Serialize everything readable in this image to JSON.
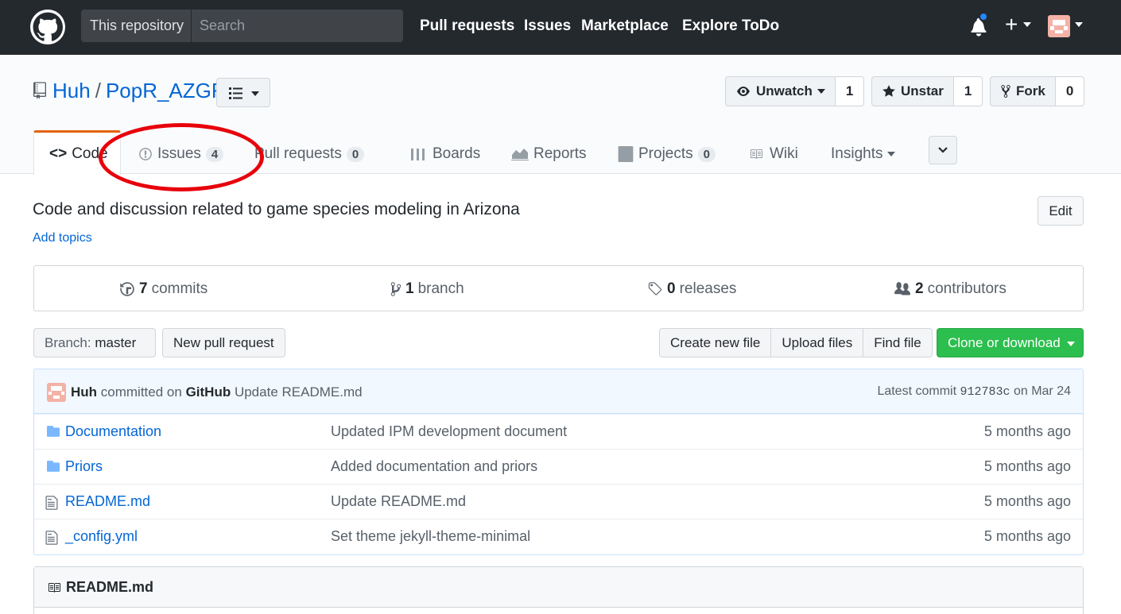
{
  "header": {
    "scope_label": "This repository",
    "search_placeholder": "Search",
    "nav": [
      "Pull requests",
      "Issues",
      "Marketplace",
      "Explore",
      "ToDo"
    ]
  },
  "repo": {
    "owner": "Huh",
    "name": "PopR_AZGF",
    "watch_label": "Unwatch",
    "watch_count": "1",
    "star_label": "Unstar",
    "star_count": "1",
    "fork_label": "Fork",
    "fork_count": "0"
  },
  "tabs": {
    "code": "Code",
    "issues": "Issues",
    "issues_count": "4",
    "pulls": "Pull requests",
    "pulls_count": "0",
    "boards": "Boards",
    "reports": "Reports",
    "projects": "Projects",
    "projects_count": "0",
    "wiki": "Wiki",
    "insights": "Insights"
  },
  "about": {
    "description": "Code and discussion related to game species modeling in Arizona",
    "add_topics": "Add topics",
    "edit": "Edit"
  },
  "summary": {
    "commits_count": "7",
    "commits_label": "commits",
    "branch_count": "1",
    "branch_label": "branch",
    "releases_count": "0",
    "releases_label": "releases",
    "contributors_count": "2",
    "contributors_label": "contributors"
  },
  "toolbar": {
    "branch_prefix": "Branch:",
    "branch_name": "master",
    "new_pr": "New pull request",
    "create_file": "Create new file",
    "upload_files": "Upload files",
    "find_file": "Find file",
    "clone": "Clone or download"
  },
  "commit": {
    "author": "Huh",
    "committed_on": "committed on",
    "platform": "GitHub",
    "message": "Update README.md",
    "latest_label": "Latest commit",
    "sha": "912783c",
    "date": "on Mar 24"
  },
  "files": [
    {
      "name": "Documentation",
      "type": "folder",
      "message": "Updated IPM development document",
      "age": "5 months ago"
    },
    {
      "name": "Priors",
      "type": "folder",
      "message": "Added documentation and priors",
      "age": "5 months ago"
    },
    {
      "name": "README.md",
      "type": "file",
      "message": "Update README.md",
      "age": "5 months ago"
    },
    {
      "name": "_config.yml",
      "type": "file",
      "message": "Set theme jekyll-theme-minimal",
      "age": "5 months ago"
    }
  ],
  "readme": {
    "title": "README.md"
  },
  "colors": {
    "accent": "#0366d6",
    "clone_green": "#2cbe4e",
    "annotation_red": "#e8000b",
    "header_bg": "#24292e"
  }
}
